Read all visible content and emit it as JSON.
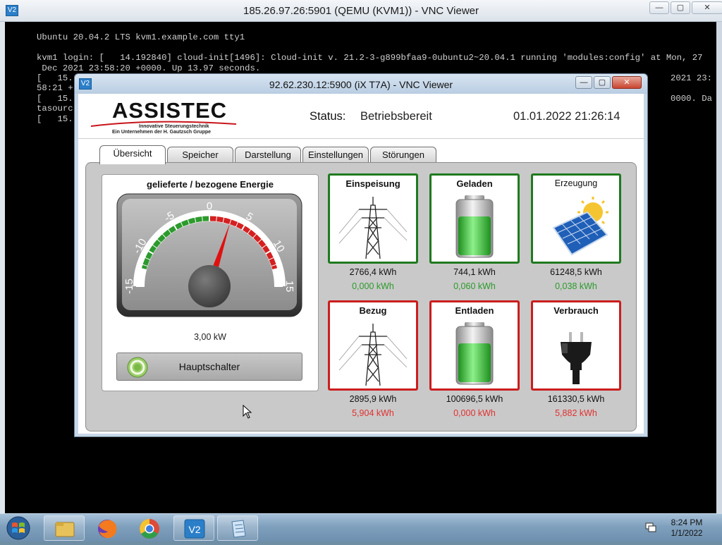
{
  "outer_window": {
    "title": "185.26.97.26:5901 (QEMU (KVM1)) - VNC Viewer",
    "icon_label": "V2",
    "controls": [
      "—",
      "▢",
      "✕"
    ]
  },
  "terminal": {
    "lines": [
      "Ubuntu 20.04.2 LTS kvm1.example.com tty1",
      "kvm1 login: [   14.192840] cloud-init[1496]: Cloud-init v. 21.2-3-g899bfaa9-0ubuntu2~20.04.1 running 'modules:config' at Mon, 27",
      " Dec 2021 23:58:20 +0000. Up 13.97 seconds.",
      "[   15.",
      "58:21 +",
      "[   15.",
      "tasourc",
      "[   15."
    ],
    "right_fragments": [
      "2021 23:",
      "0000. Da"
    ]
  },
  "inner_window": {
    "title": "92.62.230.12:5900 (iX T7A) - VNC Viewer",
    "icon_label": "V2",
    "controls": [
      "—",
      "▢",
      "✕"
    ]
  },
  "app": {
    "logo": {
      "name": "ASSISTEC",
      "tagline": "Innovative Steuerungstechnik",
      "subtitle": "Ein Unternehmen der H. Gautzsch Gruppe"
    },
    "status_label": "Status:",
    "status_value": "Betriebsbereit",
    "datetime": "01.01.2022 21:26:14",
    "tabs": [
      "Übersicht",
      "Speicher",
      "Darstellung",
      "Einstellungen",
      "Störungen"
    ],
    "active_tab": "Übersicht",
    "gauge": {
      "title": "gelieferte / bezogene Energie",
      "min": -15,
      "max": 15,
      "value": 3.0,
      "ticks": [
        "-15",
        "-10",
        "-5",
        "0",
        "5",
        "10",
        "15"
      ],
      "reading": "3,00 kW",
      "green_color": "#2d9a2d",
      "red_color": "#d42020",
      "needle_color": "#e01010"
    },
    "main_switch_label": "Hauptschalter",
    "tiles": [
      {
        "title": "Einspeisung",
        "total": "2766,4 kWh",
        "delta": "0,000 kWh",
        "status": "green",
        "icon": "power-pylon-icon"
      },
      {
        "title": "Geladen",
        "total": "744,1 kWh",
        "delta": "0,060 kWh",
        "status": "green",
        "icon": "battery-icon"
      },
      {
        "title": "Erzeugung",
        "total": "61248,5 kWh",
        "delta": "0,038 kWh",
        "status": "green",
        "icon": "solar-panel-icon"
      },
      {
        "title": "Bezug",
        "total": "2895,9 kWh",
        "delta": "5,904 kWh",
        "status": "red",
        "icon": "power-pylon-icon"
      },
      {
        "title": "Entladen",
        "total": "100696,5 kWh",
        "delta": "0,000 kWh",
        "status": "red",
        "icon": "battery-icon"
      },
      {
        "title": "Verbrauch",
        "total": "161330,5 kWh",
        "delta": "5,882 kWh",
        "status": "red",
        "icon": "power-plug-icon"
      }
    ]
  },
  "taskbar": {
    "items": [
      "file-explorer",
      "firefox",
      "chrome",
      "vnc-viewer",
      "notepad"
    ],
    "time": "8:24 PM",
    "date": "1/1/2022"
  }
}
